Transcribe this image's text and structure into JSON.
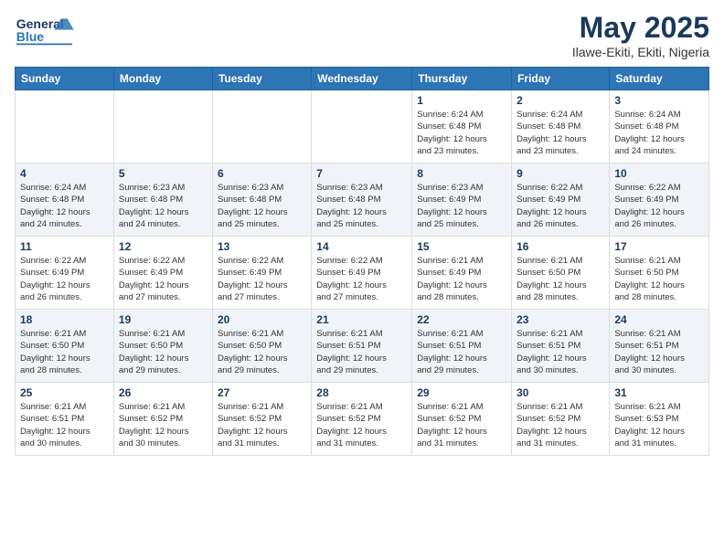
{
  "header": {
    "logo_general": "General",
    "logo_blue": "Blue",
    "month_year": "May 2025",
    "location": "Ilawe-Ekiti, Ekiti, Nigeria"
  },
  "weekdays": [
    "Sunday",
    "Monday",
    "Tuesday",
    "Wednesday",
    "Thursday",
    "Friday",
    "Saturday"
  ],
  "weeks": [
    [
      {
        "day": "",
        "info": ""
      },
      {
        "day": "",
        "info": ""
      },
      {
        "day": "",
        "info": ""
      },
      {
        "day": "",
        "info": ""
      },
      {
        "day": "1",
        "info": "Sunrise: 6:24 AM\nSunset: 6:48 PM\nDaylight: 12 hours\nand 23 minutes."
      },
      {
        "day": "2",
        "info": "Sunrise: 6:24 AM\nSunset: 6:48 PM\nDaylight: 12 hours\nand 23 minutes."
      },
      {
        "day": "3",
        "info": "Sunrise: 6:24 AM\nSunset: 6:48 PM\nDaylight: 12 hours\nand 24 minutes."
      }
    ],
    [
      {
        "day": "4",
        "info": "Sunrise: 6:24 AM\nSunset: 6:48 PM\nDaylight: 12 hours\nand 24 minutes."
      },
      {
        "day": "5",
        "info": "Sunrise: 6:23 AM\nSunset: 6:48 PM\nDaylight: 12 hours\nand 24 minutes."
      },
      {
        "day": "6",
        "info": "Sunrise: 6:23 AM\nSunset: 6:48 PM\nDaylight: 12 hours\nand 25 minutes."
      },
      {
        "day": "7",
        "info": "Sunrise: 6:23 AM\nSunset: 6:48 PM\nDaylight: 12 hours\nand 25 minutes."
      },
      {
        "day": "8",
        "info": "Sunrise: 6:23 AM\nSunset: 6:49 PM\nDaylight: 12 hours\nand 25 minutes."
      },
      {
        "day": "9",
        "info": "Sunrise: 6:22 AM\nSunset: 6:49 PM\nDaylight: 12 hours\nand 26 minutes."
      },
      {
        "day": "10",
        "info": "Sunrise: 6:22 AM\nSunset: 6:49 PM\nDaylight: 12 hours\nand 26 minutes."
      }
    ],
    [
      {
        "day": "11",
        "info": "Sunrise: 6:22 AM\nSunset: 6:49 PM\nDaylight: 12 hours\nand 26 minutes."
      },
      {
        "day": "12",
        "info": "Sunrise: 6:22 AM\nSunset: 6:49 PM\nDaylight: 12 hours\nand 27 minutes."
      },
      {
        "day": "13",
        "info": "Sunrise: 6:22 AM\nSunset: 6:49 PM\nDaylight: 12 hours\nand 27 minutes."
      },
      {
        "day": "14",
        "info": "Sunrise: 6:22 AM\nSunset: 6:49 PM\nDaylight: 12 hours\nand 27 minutes."
      },
      {
        "day": "15",
        "info": "Sunrise: 6:21 AM\nSunset: 6:49 PM\nDaylight: 12 hours\nand 28 minutes."
      },
      {
        "day": "16",
        "info": "Sunrise: 6:21 AM\nSunset: 6:50 PM\nDaylight: 12 hours\nand 28 minutes."
      },
      {
        "day": "17",
        "info": "Sunrise: 6:21 AM\nSunset: 6:50 PM\nDaylight: 12 hours\nand 28 minutes."
      }
    ],
    [
      {
        "day": "18",
        "info": "Sunrise: 6:21 AM\nSunset: 6:50 PM\nDaylight: 12 hours\nand 28 minutes."
      },
      {
        "day": "19",
        "info": "Sunrise: 6:21 AM\nSunset: 6:50 PM\nDaylight: 12 hours\nand 29 minutes."
      },
      {
        "day": "20",
        "info": "Sunrise: 6:21 AM\nSunset: 6:50 PM\nDaylight: 12 hours\nand 29 minutes."
      },
      {
        "day": "21",
        "info": "Sunrise: 6:21 AM\nSunset: 6:51 PM\nDaylight: 12 hours\nand 29 minutes."
      },
      {
        "day": "22",
        "info": "Sunrise: 6:21 AM\nSunset: 6:51 PM\nDaylight: 12 hours\nand 29 minutes."
      },
      {
        "day": "23",
        "info": "Sunrise: 6:21 AM\nSunset: 6:51 PM\nDaylight: 12 hours\nand 30 minutes."
      },
      {
        "day": "24",
        "info": "Sunrise: 6:21 AM\nSunset: 6:51 PM\nDaylight: 12 hours\nand 30 minutes."
      }
    ],
    [
      {
        "day": "25",
        "info": "Sunrise: 6:21 AM\nSunset: 6:51 PM\nDaylight: 12 hours\nand 30 minutes."
      },
      {
        "day": "26",
        "info": "Sunrise: 6:21 AM\nSunset: 6:52 PM\nDaylight: 12 hours\nand 30 minutes."
      },
      {
        "day": "27",
        "info": "Sunrise: 6:21 AM\nSunset: 6:52 PM\nDaylight: 12 hours\nand 31 minutes."
      },
      {
        "day": "28",
        "info": "Sunrise: 6:21 AM\nSunset: 6:52 PM\nDaylight: 12 hours\nand 31 minutes."
      },
      {
        "day": "29",
        "info": "Sunrise: 6:21 AM\nSunset: 6:52 PM\nDaylight: 12 hours\nand 31 minutes."
      },
      {
        "day": "30",
        "info": "Sunrise: 6:21 AM\nSunset: 6:52 PM\nDaylight: 12 hours\nand 31 minutes."
      },
      {
        "day": "31",
        "info": "Sunrise: 6:21 AM\nSunset: 6:53 PM\nDaylight: 12 hours\nand 31 minutes."
      }
    ]
  ]
}
